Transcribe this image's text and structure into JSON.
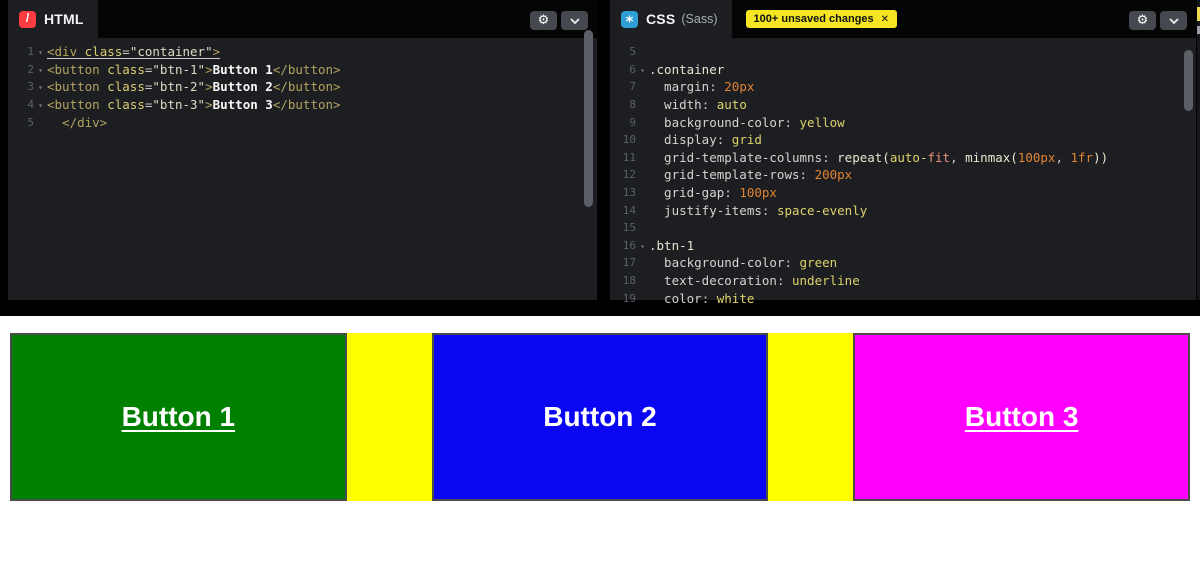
{
  "editor": {
    "html": {
      "tab_label": "HTML",
      "lines": [
        {
          "n": "1",
          "fold": true,
          "u": true,
          "tokens": [
            [
              "<div ",
              "tag"
            ],
            [
              "class",
              "attr"
            ],
            [
              "=",
              "pun"
            ],
            [
              "\"container\"",
              "str"
            ],
            [
              ">",
              "tag"
            ]
          ]
        },
        {
          "n": "2",
          "fold": true,
          "tokens": [
            [
              "<button ",
              "tag"
            ],
            [
              "class",
              "attr"
            ],
            [
              "=",
              "pun"
            ],
            [
              "\"btn-1\"",
              "str"
            ],
            [
              ">",
              "tag"
            ],
            [
              "Button 1",
              "txt"
            ],
            [
              "</button>",
              "tag"
            ]
          ]
        },
        {
          "n": "3",
          "fold": true,
          "tokens": [
            [
              "<button ",
              "tag"
            ],
            [
              "class",
              "attr"
            ],
            [
              "=",
              "pun"
            ],
            [
              "\"btn-2\"",
              "str"
            ],
            [
              ">",
              "tag"
            ],
            [
              "Button 2",
              "txt"
            ],
            [
              "</button>",
              "tag"
            ]
          ]
        },
        {
          "n": "4",
          "fold": true,
          "tokens": [
            [
              "<button ",
              "tag"
            ],
            [
              "class",
              "attr"
            ],
            [
              "=",
              "pun"
            ],
            [
              "\"btn-3\"",
              "str"
            ],
            [
              ">",
              "tag"
            ],
            [
              "Button 3",
              "txt"
            ],
            [
              "</button>",
              "tag"
            ]
          ]
        },
        {
          "n": "5",
          "fold": false,
          "tokens": [
            [
              "  </div>",
              "tag"
            ]
          ]
        }
      ]
    },
    "css": {
      "tab_label": "CSS",
      "tab_sublabel": "(Sass)",
      "badge_text": "100+ unsaved changes",
      "badge_close": "✕",
      "lines": [
        {
          "n": "5",
          "tokens": []
        },
        {
          "n": "6",
          "fold": true,
          "tokens": [
            [
              ".container",
              "sel"
            ]
          ]
        },
        {
          "n": "7",
          "tokens": [
            [
              "  margin",
              "prop"
            ],
            [
              ": ",
              "pun"
            ],
            [
              "20px",
              "num"
            ]
          ]
        },
        {
          "n": "8",
          "tokens": [
            [
              "  width",
              "prop"
            ],
            [
              ": ",
              "pun"
            ],
            [
              "auto",
              "kw"
            ]
          ]
        },
        {
          "n": "9",
          "tokens": [
            [
              "  background-color",
              "prop"
            ],
            [
              ": ",
              "pun"
            ],
            [
              "yellow",
              "kw"
            ]
          ]
        },
        {
          "n": "10",
          "tokens": [
            [
              "  display",
              "prop"
            ],
            [
              ": ",
              "pun"
            ],
            [
              "grid",
              "kw"
            ]
          ]
        },
        {
          "n": "11",
          "tokens": [
            [
              "  grid-template-columns",
              "prop"
            ],
            [
              ": ",
              "pun"
            ],
            [
              "repeat(",
              "fn"
            ],
            [
              "auto-",
              "kw"
            ],
            [
              "fit",
              "fit"
            ],
            [
              ", ",
              "pun"
            ],
            [
              "minmax(",
              "fn"
            ],
            [
              "100px",
              "num"
            ],
            [
              ", ",
              "pun"
            ],
            [
              "1fr",
              "num"
            ],
            [
              "))",
              "fn"
            ]
          ]
        },
        {
          "n": "12",
          "tokens": [
            [
              "  grid-template-rows",
              "prop"
            ],
            [
              ": ",
              "pun"
            ],
            [
              "200px",
              "num"
            ]
          ]
        },
        {
          "n": "13",
          "tokens": [
            [
              "  grid-gap",
              "prop"
            ],
            [
              ": ",
              "pun"
            ],
            [
              "100px",
              "num"
            ]
          ]
        },
        {
          "n": "14",
          "tokens": [
            [
              "  justify-items",
              "prop"
            ],
            [
              ": ",
              "pun"
            ],
            [
              "space-evenly",
              "kw"
            ]
          ]
        },
        {
          "n": "15",
          "tokens": []
        },
        {
          "n": "16",
          "fold": true,
          "tokens": [
            [
              ".btn-1",
              "sel"
            ]
          ]
        },
        {
          "n": "17",
          "tokens": [
            [
              "  background-color",
              "prop"
            ],
            [
              ": ",
              "pun"
            ],
            [
              "green",
              "kw"
            ]
          ]
        },
        {
          "n": "18",
          "tokens": [
            [
              "  text-decoration",
              "prop"
            ],
            [
              ": ",
              "pun"
            ],
            [
              "underline",
              "kw"
            ]
          ]
        },
        {
          "n": "19",
          "tokens": [
            [
              "  color",
              "prop"
            ],
            [
              ": ",
              "pun"
            ],
            [
              "white",
              "kw"
            ]
          ]
        }
      ]
    }
  },
  "preview": {
    "container_color": "#ffff00",
    "buttons": [
      {
        "label": "Button 1",
        "bg": "#008000",
        "underline": true
      },
      {
        "label": "Button 2",
        "bg": "#0b06f2",
        "underline": false
      },
      {
        "label": "Button 3",
        "bg": "#ff00ff",
        "underline": true
      }
    ]
  },
  "colors": {
    "editor_bg": "#1d1e22",
    "html_icon": "#ff3c41",
    "sass_icon": "#2e9fd4",
    "badge_bg": "#f5e523"
  }
}
